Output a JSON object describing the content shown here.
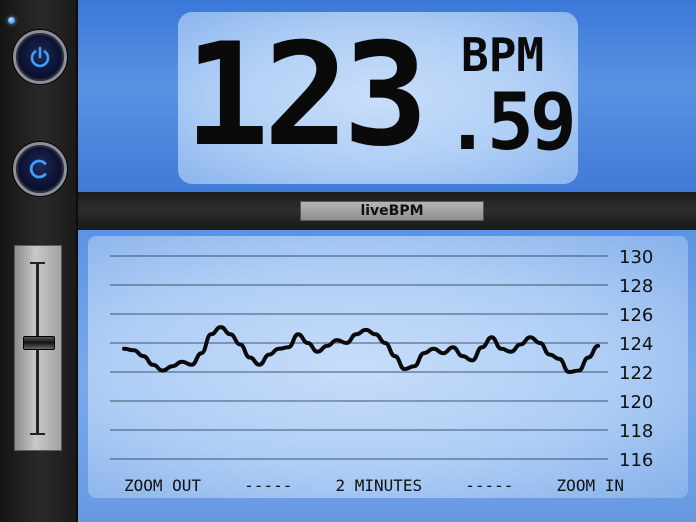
{
  "bpm": {
    "integer": "123",
    "decimal": ".59",
    "unit": "BPM"
  },
  "app": {
    "name": "liveBPM"
  },
  "controls": {
    "power_icon": "power-icon",
    "clear_icon": "reset-c-icon",
    "slider_level": 0.53
  },
  "zoom": {
    "out_label": "ZOOM OUT",
    "dashes_left": "-----",
    "window_label": "2 MINUTES",
    "dashes_right": "-----",
    "in_label": "ZOOM IN"
  },
  "colors": {
    "panel_blue": "#4d86dc",
    "panel_glow": "#c7ddfa",
    "frame_dark": "#1c1c1c",
    "text": "#0a0a0a"
  },
  "chart_data": {
    "type": "line",
    "title": "",
    "xlabel": "",
    "ylabel": "",
    "ylim": [
      116,
      130
    ],
    "yticks": [
      130,
      128,
      126,
      124,
      122,
      120,
      118,
      116
    ],
    "y_tick_position": "right",
    "grid": true,
    "series": [
      {
        "values": [
          123.6,
          123.5,
          123.1,
          122.5,
          122.1,
          122.4,
          122.7,
          122.5,
          123.3,
          124.6,
          125.1,
          124.6,
          123.9,
          123.0,
          122.5,
          123.2,
          123.6,
          123.7,
          124.6,
          124.0,
          123.4,
          123.8,
          124.2,
          124.0,
          124.6,
          124.9,
          124.6,
          124.0,
          123.1,
          122.2,
          122.4,
          123.3,
          123.6,
          123.3,
          123.7,
          123.1,
          122.8,
          123.7,
          124.4,
          123.6,
          123.4,
          123.9,
          124.4,
          124.0,
          123.2,
          122.9,
          122.0,
          122.1,
          123.0,
          123.8
        ]
      }
    ]
  }
}
